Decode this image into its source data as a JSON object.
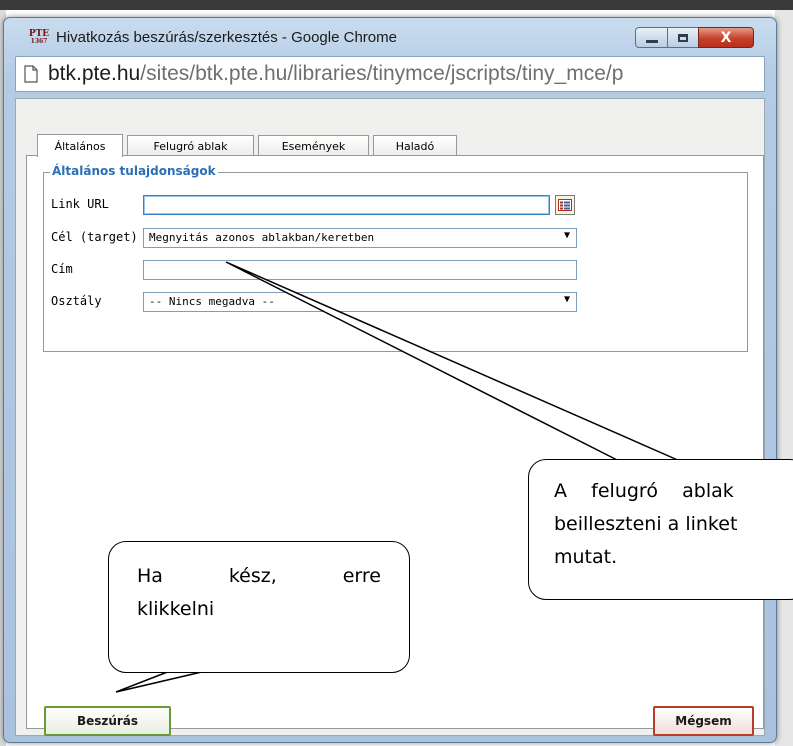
{
  "window": {
    "title": "Hivatkozás beszúrás/szerkesztés - Google Chrome",
    "icon_text_top": "PTE",
    "icon_text_bottom": "1367",
    "controls": {
      "minimize": "minimize",
      "maximize": "maximize",
      "close": "X"
    }
  },
  "address": {
    "host": "btk.pte.hu",
    "path": "/sites/btk.pte.hu/libraries/tinymce/jscripts/tiny_mce/p"
  },
  "tabs": [
    {
      "label": "Általános",
      "active": true
    },
    {
      "label": "Felugró ablak",
      "active": false
    },
    {
      "label": "Események",
      "active": false
    },
    {
      "label": "Haladó",
      "active": false
    }
  ],
  "fieldset": {
    "legend": "Általános tulajdonságok",
    "fields": {
      "link_url": {
        "label": "Link URL",
        "value": ""
      },
      "target": {
        "label": "Cél (target)",
        "value": "Megnyitás azonos ablakban/keretben"
      },
      "title": {
        "label": "Cím",
        "value": ""
      },
      "class": {
        "label": "Osztály",
        "value": "-- Nincs megadva --"
      }
    }
  },
  "buttons": {
    "insert": "Beszúrás",
    "cancel": "Mégsem"
  },
  "callouts": {
    "right_lines": [
      "A",
      "felugró",
      "ablak",
      "beilleszteni a linket",
      "mutat."
    ],
    "left_words": [
      "Ha",
      "kész,",
      "erre"
    ],
    "left_line2": "klikkelni"
  },
  "colors": {
    "legend_blue": "#2b6fb6",
    "insert_border": "#6a9a34",
    "cancel_border": "#b83c2a",
    "close_button": "#c6412a"
  }
}
